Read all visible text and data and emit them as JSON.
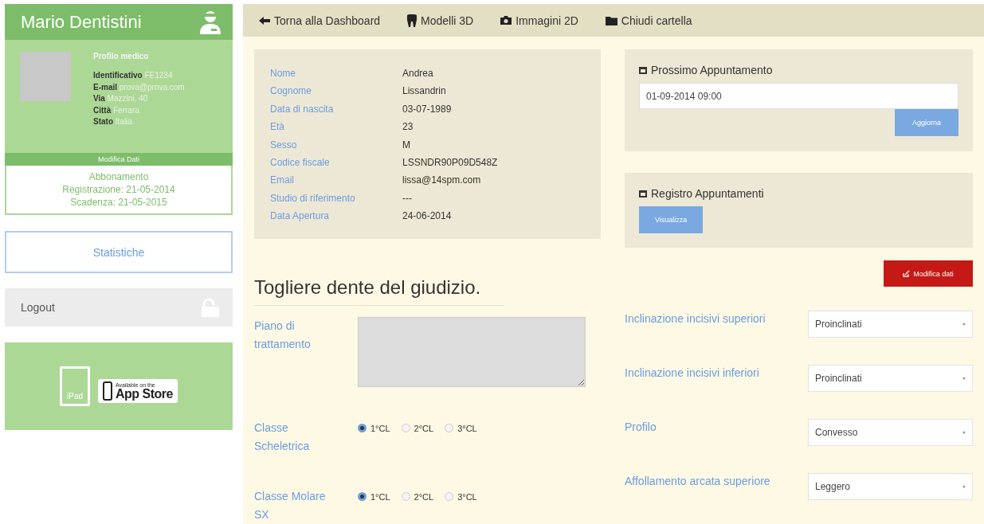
{
  "sidebar": {
    "user_name": "Mario Dentistini",
    "profile": {
      "heading": "Profilo medico",
      "fields": [
        {
          "label": "Identificativo",
          "value": "FE1234"
        },
        {
          "label": "E-mail",
          "value": "prova@prova.com"
        },
        {
          "label": "Via",
          "value": "Mazzini, 40"
        },
        {
          "label": "Città",
          "value": "Ferrara"
        },
        {
          "label": "Stato",
          "value": "Italia"
        }
      ],
      "edit_button": "Modifica Dati"
    },
    "subscription": [
      "Abbonamento",
      "Registrazione: 21-05-2014",
      "Scadenza: 21-05-2015"
    ],
    "stats_button": "Statistiche",
    "logout_button": "Logout",
    "app_badge": {
      "device_label": "iPad",
      "small_text": "Available on the",
      "big_text": "App Store"
    }
  },
  "topbar": {
    "items": [
      {
        "label": "Torna alla Dashboard"
      },
      {
        "label": "Modelli 3D"
      },
      {
        "label": "Immagini 2D"
      },
      {
        "label": "Chiudi cartella"
      }
    ]
  },
  "patient": {
    "fields": [
      {
        "label": "Nome",
        "value": "Andrea"
      },
      {
        "label": "Cognome",
        "value": "Lissandrin"
      },
      {
        "label": "Data di nascita",
        "value": "03-07-1989"
      },
      {
        "label": "Età",
        "value": "23"
      },
      {
        "label": "Sesso",
        "value": "M"
      },
      {
        "label": "Codice fiscale",
        "value": "LSSNDR90P09D548Z"
      },
      {
        "label": "Email",
        "value": "lissa@14spm.com"
      },
      {
        "label": "Studio di riferimento",
        "value": "---"
      },
      {
        "label": "Data Apertura",
        "value": "24-06-2014"
      }
    ]
  },
  "next_appointment": {
    "title": "Prossimo Appuntamento",
    "value": "01-09-2014 09:00",
    "button": "Aggiorna"
  },
  "appointment_log": {
    "title": "Registro Appuntamenti",
    "button": "Visualizza"
  },
  "treatment": {
    "title": "Togliere dente del giudizio.",
    "edit_button": "Modifica dati",
    "plan_label": "Piano di trattamento",
    "radio_groups": [
      {
        "label": "Classe Scheletrica",
        "options": [
          {
            "label": "1°CL",
            "selected": true
          },
          {
            "label": "2°CL",
            "selected": false
          },
          {
            "label": "3°CL",
            "selected": false
          }
        ]
      },
      {
        "label": "Classe Molare SX",
        "options": [
          {
            "label": "1°CL",
            "selected": true
          },
          {
            "label": "2°CL",
            "selected": false
          },
          {
            "label": "3°CL",
            "selected": false
          }
        ]
      }
    ],
    "selects": [
      {
        "label": "Inclinazione incisivi superiori",
        "value": "Proinclinati"
      },
      {
        "label": "Inclinazione incisivi inferiori",
        "value": "Proinclinati"
      },
      {
        "label": "Profilo",
        "value": "Convesso"
      },
      {
        "label": "Affollamento arcata superiore",
        "value": "Leggero"
      }
    ]
  }
}
